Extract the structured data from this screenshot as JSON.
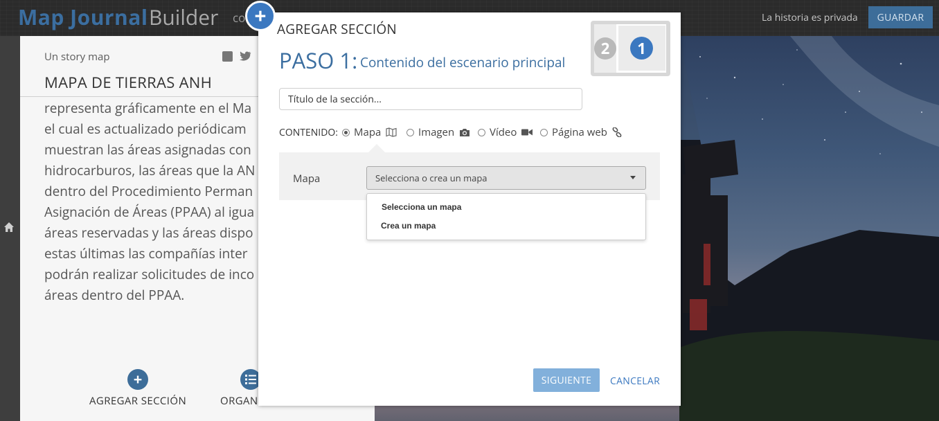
{
  "header": {
    "title_main": "Map Journal",
    "title_secondary": "Builder",
    "title_suffix": "co",
    "privacy_status": "La historia es privada",
    "save_label": "GUARDAR"
  },
  "story": {
    "label": "Un story map",
    "title": "MAPA DE TIERRAS ANH",
    "body_lines": [
      "representa gráficamente en el Ma",
      "el cual es actualizado periódicam",
      "muestran las áreas asignadas con",
      "hidrocarburos, las áreas que la AN",
      "dentro del Procedimiento Perman",
      "Asignación de Áreas (PPAA) al igua",
      "áreas reservadas y las áreas dispo",
      "estas últimas las compañías inter",
      "podrán realizar solicitudes de inco",
      "áreas dentro del PPAA."
    ],
    "add_section_label": "AGREGAR SECCIÓN",
    "organize_label": "ORGAN"
  },
  "modal": {
    "heading": "AGREGAR SECCIÓN",
    "step_number": "PASO 1:",
    "step_description": "Contenido del escenario principal",
    "layout_badges": {
      "secondary": "2",
      "main": "1"
    },
    "section_title_placeholder": "Título de la sección...",
    "content_label": "CONTENIDO:",
    "content_options": [
      {
        "label": "Mapa",
        "selected": true,
        "icon": "map-icon"
      },
      {
        "label": "Imagen",
        "selected": false,
        "icon": "camera-icon"
      },
      {
        "label": "Vídeo",
        "selected": false,
        "icon": "video-camera-icon"
      },
      {
        "label": "Página web",
        "selected": false,
        "icon": "link-icon"
      }
    ],
    "map_label": "Mapa",
    "map_select_value": "Selecciona o crea un mapa",
    "dropdown_options": [
      "Selecciona un mapa",
      "Crea un mapa"
    ],
    "next_label": "SIGUIENTE",
    "cancel_label": "CANCELAR"
  },
  "colors": {
    "accent_blue": "#3b78c0",
    "header_bg": "#2b2b2b",
    "save_button": "#3d6d99",
    "next_button": "#82b0db"
  }
}
